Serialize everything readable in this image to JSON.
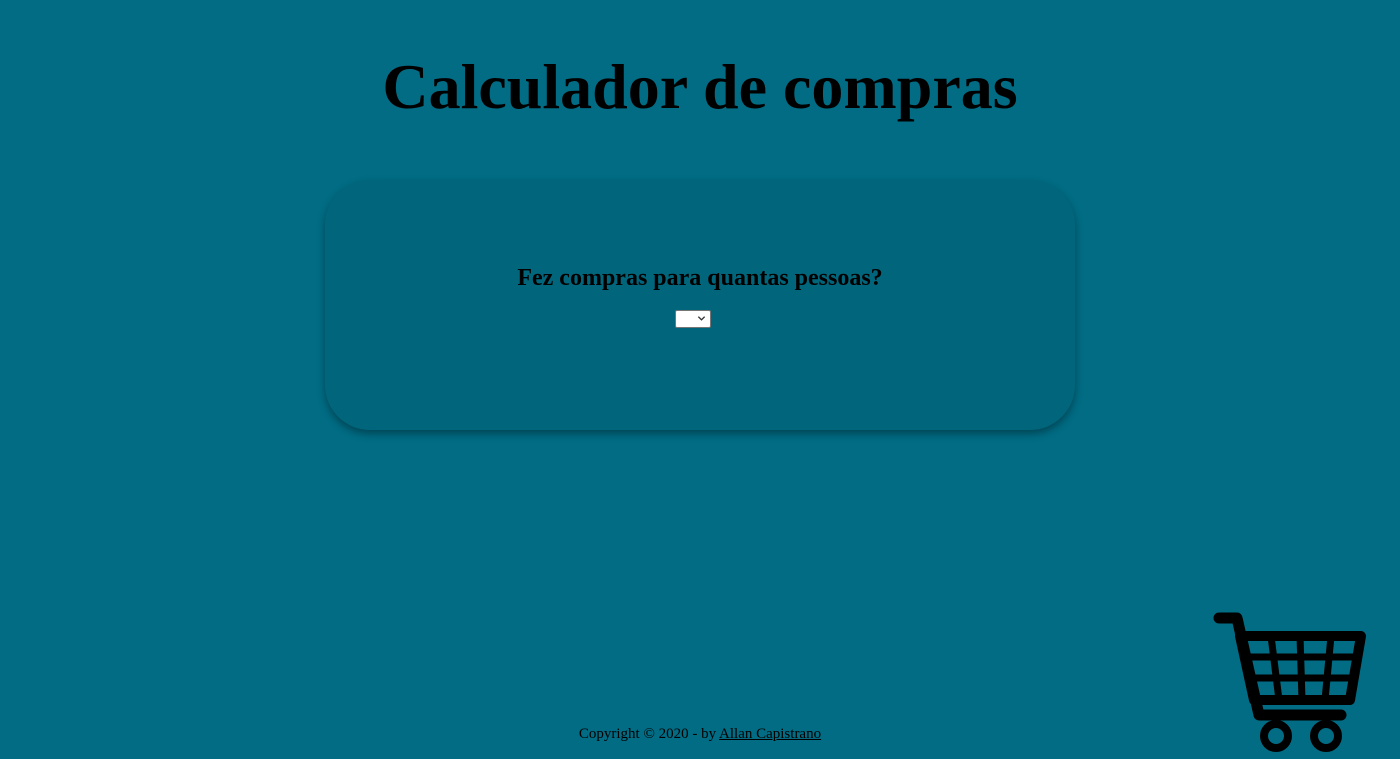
{
  "page": {
    "title": "Calculador de compras"
  },
  "card": {
    "question": "Fez compras para quantas pessoas?",
    "people_select": {
      "selected_value": ""
    }
  },
  "footer": {
    "copyright_text": "Copyright © 2020 - by ",
    "author_link": "Allan Capistrano"
  },
  "icons": {
    "cart": "shopping-cart-icon",
    "select_arrow": "chevron-down-icon"
  },
  "colors": {
    "background": "#016c84",
    "card": "#01667c",
    "text": "#000000"
  }
}
